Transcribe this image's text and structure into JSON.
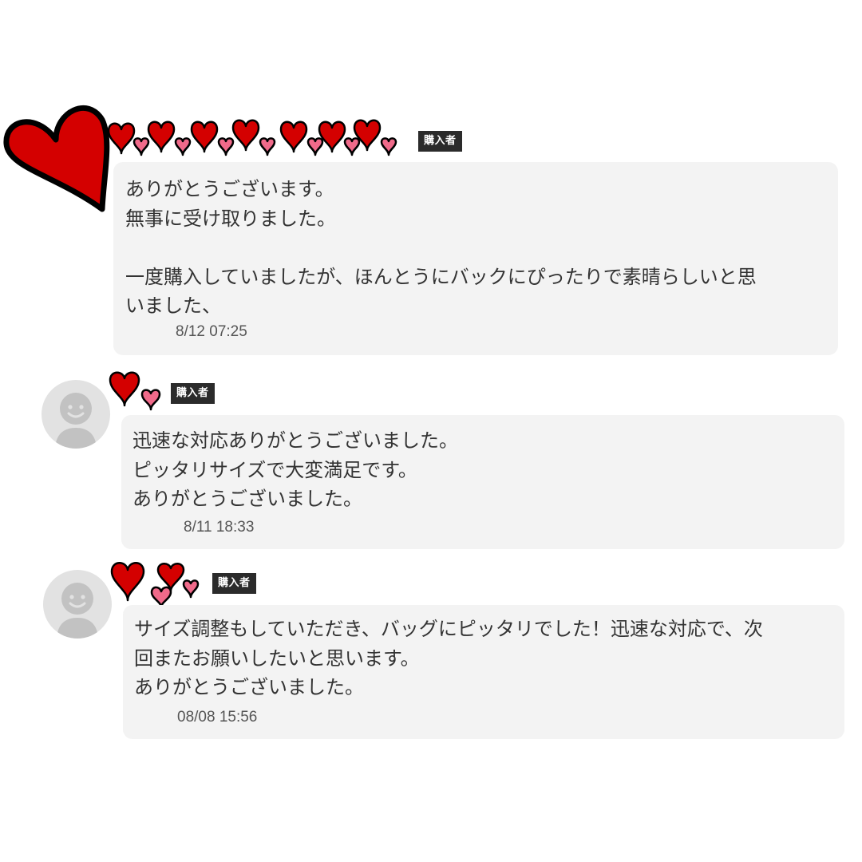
{
  "colors": {
    "bubble": "#f3f3f3",
    "badge": "#2b2b2b",
    "text": "#333333",
    "timestamp": "#555555",
    "heart_red": "#d40000",
    "heart_pink": "#f06a8a",
    "avatar": "#e2e2e2"
  },
  "reviews": [
    {
      "badge": "購入者",
      "message": "ありがとうございます。\n無事に受け取りました。\n\n一度購入していましたが、ほんとうにバックにぴったりで素晴らしいと思\nいました、",
      "timestamp": "8/12 07:25",
      "avatar_icon": "big-red-heart-icon"
    },
    {
      "badge": "購入者",
      "message": "迅速な対応ありがとうございました。\nピッタリサイズで大変満足です。\nありがとうございました。",
      "timestamp": "8/11 18:33",
      "avatar_icon": "default-user-avatar-icon"
    },
    {
      "badge": "購入者",
      "message": "サイズ調整もしていただき、バッグにピッタリでした！迅速な対応で、次\n回またお願いしたいと思います。\nありがとうございました。",
      "timestamp": "08/08 15:56",
      "avatar_icon": "default-user-avatar-icon"
    }
  ]
}
